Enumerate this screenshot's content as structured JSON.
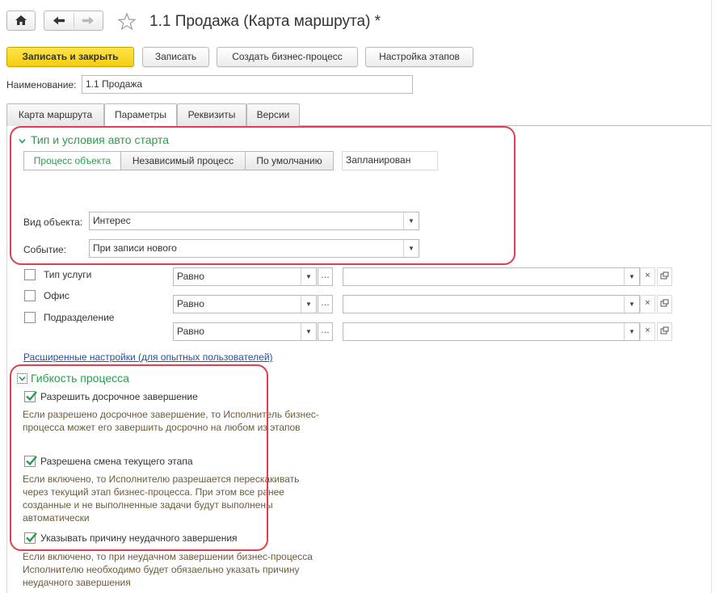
{
  "header": {
    "title": "1.1 Продажа (Карта маршрута) *"
  },
  "toolbar": {
    "save_close": "Записать и закрыть",
    "save": "Записать",
    "create_bp": "Создать бизнес-процесс",
    "stages_setup": "Настройка этапов"
  },
  "name_field": {
    "label": "Наименование:",
    "value": "1.1 Продажа"
  },
  "tabs": [
    {
      "label": "Карта маршрута"
    },
    {
      "label": "Параметры"
    },
    {
      "label": "Реквизиты"
    },
    {
      "label": "Версии"
    }
  ],
  "autostart": {
    "title": "Тип и условия авто старта",
    "modes": [
      "Процесс объекта",
      "Независимый процесс",
      "По умолчанию"
    ],
    "status": "Запланирован",
    "object_type_label": "Вид объекта:",
    "object_type_value": "Интерес",
    "event_label": "Событие:",
    "event_value": "При записи нового"
  },
  "conditions": [
    {
      "label": "Тип услуги",
      "operator": "Равно",
      "value": ""
    },
    {
      "label": "Офис",
      "operator": "Равно",
      "value": ""
    },
    {
      "label": "Подразделение",
      "operator": "Равно",
      "value": ""
    }
  ],
  "advanced_link": "Расширенные настройки (для опытных пользователей)",
  "flexibility": {
    "title": "Гибкость процесса",
    "options": [
      {
        "label": "Разрешить досрочное завершение",
        "checked": true,
        "description": "Если разрешено досрочное завершение, то Исполнитель бизнес-процесса может его завершить досрочно на любом из этапов"
      },
      {
        "label": "Разрешена смена текущего этапа",
        "checked": true,
        "description": "Если включено, то Исполнителю разрешается перескакивать через текущий этап  бизнес-процесса. При этом все ранее созданные и не выполненные задачи будут выполнены автоматически"
      },
      {
        "label": "Указывать причину неудачного завершения",
        "checked": true,
        "description": "Если включено, то при неудачном завершении бизнес-процесса Исполнителю необходимо будет обязаельно указать причину неудачного завершения"
      }
    ]
  },
  "colors": {
    "accent_green": "#2c9a4c",
    "highlight_red": "#e0404a",
    "primary_yellow": "#f5ce0f"
  }
}
